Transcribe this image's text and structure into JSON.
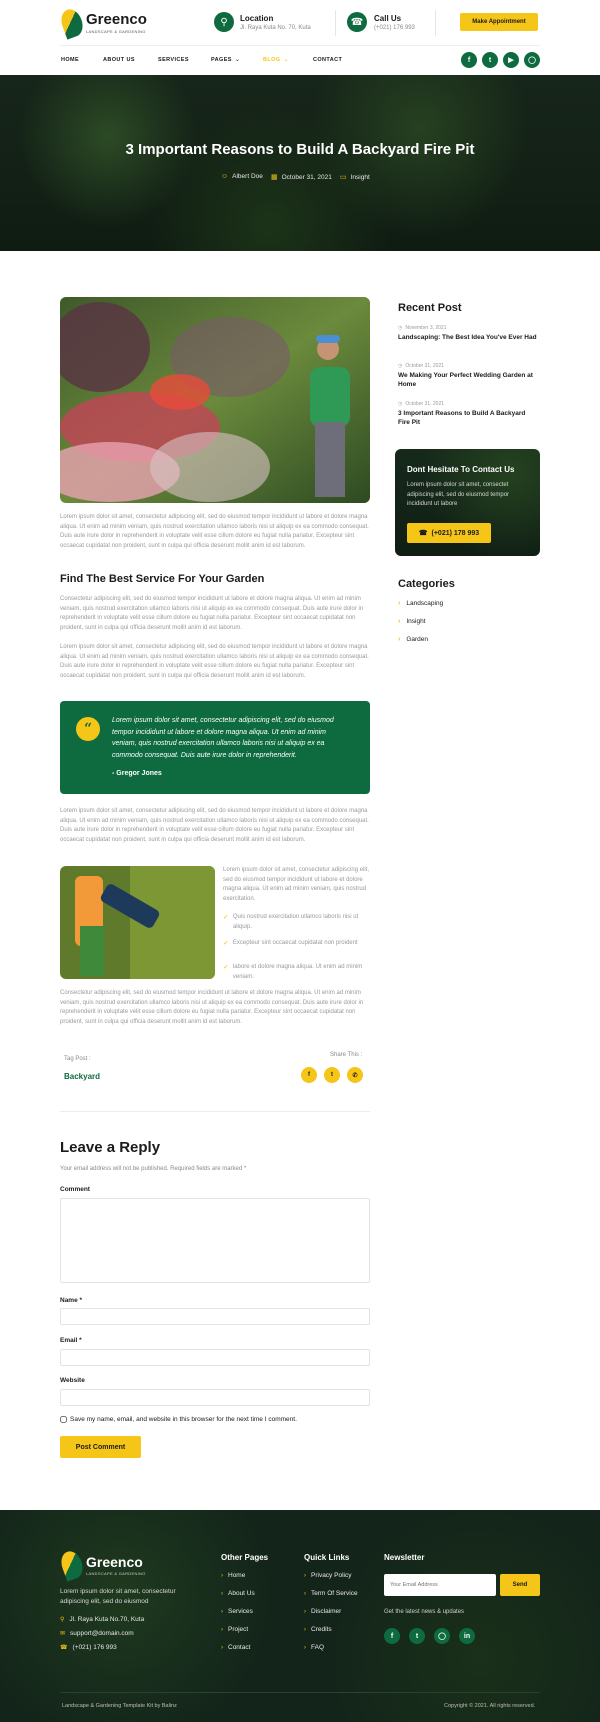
{
  "brand": {
    "name": "Greenco",
    "tagline": "LANDSCAPE & GARDENING"
  },
  "header": {
    "location_title": "Location",
    "location_value": "Jl. Raya Kuta No. 70, Kuta",
    "call_title": "Call Us",
    "call_value": "(+021) 176 993",
    "cta_label": "Make Appointment"
  },
  "nav": {
    "items": [
      "HOME",
      "ABOUT US",
      "SERVICES",
      "PAGES",
      "BLOG",
      "CONTACT"
    ],
    "social_icons": [
      "facebook-icon",
      "twitter-icon",
      "youtube-icon",
      "instagram-icon"
    ]
  },
  "hero": {
    "title": "3 Important Reasons to Build A Backyard Fire Pit",
    "author": "Albert Doe",
    "date": "October 31, 2021",
    "category": "Insight"
  },
  "article": {
    "para1": "Lorem ipsum dolor sit amet, consectetur adipiscing elit, sed do eiusmod tempor incididunt ut labore et dolore magna aliqua. Ut enim ad minim veniam, quis nostrud exercitation ullamco laboris nisi ut aliquip ex ea commodo consequat. Duis aute irure dolor in reprehenderit in voluptate velit esse cillum dolore eu fugiat nulla pariatur. Excepteur sint occaecat cupidatat non proident, sunt in culpa qui officia deserunt mollit anim id est laborum.",
    "subheading": "Find The Best Service For Your Garden",
    "para2": "Consectetur adipiscing elit, sed do eiusmod tempor incididunt ut labore et dolore magna aliqua. Ut enim ad minim veniam, quis nostrud exercitation ullamco laboris nisi ut aliquip ex ea commodo consequat. Duis aute irure dolor in reprehenderit in voluptate velit esse cillum dolore eu fugiat nulla pariatur. Excepteur sint occaecat cupidatat non proident, sunt in culpa qui officia deserunt mollit anim id est laborum.",
    "para3": "Lorem ipsum dolor sit amet, consectetur adipiscing elit, sed do eiusmod tempor incididunt ut labore et dolore magna aliqua. Ut enim ad minim veniam, quis nostrud exercitation ullamco laboris nisi ut aliquip ex ea commodo consequat. Duis aute irure dolor in reprehenderit in voluptate velit esse cillum dolore eu fugiat nulla pariatur. Excepteur sint occaecat cupidatat non proident, sunt in culpa qui officia deserunt mollit anim id est laborum.",
    "quote": "Lorem ipsum dolor sit amet, consectetur adipiscing elit, sed do eiusmod tempor incididunt ut labore et dolore magna aliqua. Ut enim ad minim veniam, quis nostrud exercitation ullamco laboris nisi ut aliquip ex ea commodo consequat. Duis aute irure dolor in reprehenderit.",
    "quote_author": "- Gregor Jones",
    "para4": "Lorem ipsum dolor sit amet, consectetur adipiscing elit, sed do eiusmod tempor incididunt ut labore et dolore magna aliqua. Ut enim ad minim veniam, quis nostrud exercitation ullamco laboris nisi ut aliquip ex ea commodo consequat. Duis aute irure dolor in reprehenderit in voluptate velit esse cillum dolore eu fugiat nulla pariatur. Excepteur sint occaecat cupidatat non proident, sunt in culpa qui officia deserunt mollit anim id est laborum.",
    "side_para": "Lorem ipsum dolor sit amet, consectetur adipiscing elit, sed do eiusmod tempor incididunt ut labore et dolore magna aliqua. Ut enim ad minim veniam, quis nostrud exercitation.",
    "checks": [
      "Quis nostrud exercitation ullamco laboris nisi ut aliquip.",
      "Excepteur sint occaecat cupidatat non proident",
      "labore et dolore magna aliqua. Ut enim ad minim veniam."
    ],
    "para5": "Consectetur adipiscing elit, sed do eiusmod tempor incididunt ut labore et dolore magna aliqua. Ut enim ad minim veniam, quis nostrud exercitation ullamco laboris nisi ut aliquip ex ea commodo consequat. Duis aute irure dolor in reprehenderit in voluptate velit esse cillum dolore eu fugiat nulla pariatur. Excepteur sint occaecat cupidatat non proident, sunt in culpa qui officia deserunt mollit anim id est laborum.",
    "tag_label": "Tag Post :",
    "tag": "Backyard",
    "share_label": "Share This :",
    "share_icons": [
      "facebook-icon",
      "twitter-icon",
      "whatsapp-icon"
    ]
  },
  "sidebar": {
    "recent_title": "Recent Post",
    "recent": [
      {
        "date": "November 3, 2021",
        "title": "Landscaping: The Best Idea You've Ever Had"
      },
      {
        "date": "October 31, 2021",
        "title": "We Making Your Perfect Wedding Garden at Home"
      },
      {
        "date": "October 31, 2021",
        "title": "3 Important Reasons to Build A Backyard Fire Pit"
      }
    ],
    "contact_title": "Dont Hesitate To Contact Us",
    "contact_text": "Lorem ipsum dolor sit amet, consectet adipiscing elit, sed do eiusmod tempor incididunt ut labore",
    "contact_phone": "(+021) 178 993",
    "categories_title": "Categories",
    "categories": [
      "Landscaping",
      "Insight",
      "Garden"
    ]
  },
  "reply": {
    "title": "Leave a Reply",
    "note": "Your email address will not be published. Required fields are marked *",
    "comment_label": "Comment",
    "name_label": "Name *",
    "email_label": "Email *",
    "website_label": "Website",
    "save_label": "Save my name, email, and website in this browser for the next time I comment.",
    "submit_label": "Post Comment"
  },
  "footer": {
    "about": "Lorem ipsum dolor sit amet, consectetur adipiscing elit, sed do eiusmod",
    "address": "Jl. Raya Kuta No.70, Kuta",
    "email": "support@domain.com",
    "phone": "(+021) 176 993",
    "other_title": "Other Pages",
    "other_links": [
      "Home",
      "About Us",
      "Services",
      "Project",
      "Contact"
    ],
    "quick_title": "Quick Links",
    "quick_links": [
      "Privacy Policy",
      "Term Of Service",
      "Disclaimer",
      "Credits",
      "FAQ"
    ],
    "newsletter_title": "Newsletter",
    "newsletter_placeholder": "Your Email Address",
    "newsletter_button": "Send",
    "newsletter_note": "Get the latest news & updates",
    "credit_left": "Landscape & Gardening Template Kit by Balinz",
    "credit_right": "Copyright © 2021. All rights reserved."
  },
  "colors": {
    "primary_green": "#0e6b40",
    "accent_yellow": "#f5c518",
    "dark_bg": "#13251a"
  }
}
